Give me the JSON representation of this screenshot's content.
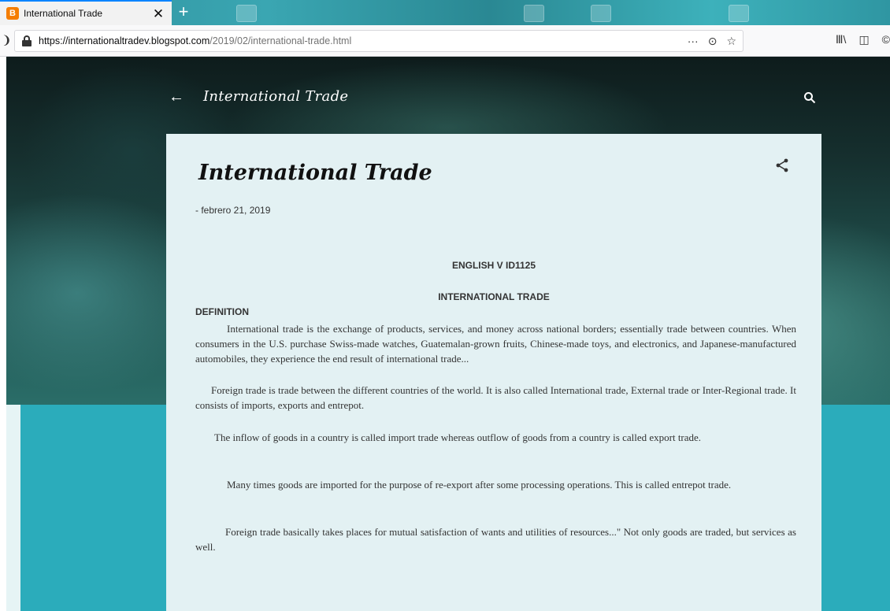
{
  "browser": {
    "tab": {
      "title": "International Trade",
      "favicon": "B",
      "close": "✕"
    },
    "new_tab": "+",
    "url_host": "https://internationaltradev.blogspot.com",
    "url_path": "/2019/02/international-trade.html",
    "url_actions": {
      "more": "···",
      "pocket": "⊙",
      "bookmark": "☆"
    },
    "toolbar_right": {
      "library": "Ⅲ\\",
      "sidebar": "◫",
      "extension": "©"
    }
  },
  "blog": {
    "title": "International Trade",
    "back_arrow": "←"
  },
  "post": {
    "title": "International Trade",
    "date": "- febrero 21, 2019",
    "heading_1": "ENGLISH V ID1125",
    "heading_2": "INTERNATIONAL TRADE",
    "definition_heading": "DEFINITION",
    "paragraphs": [
      "International trade is the exchange of products, services, and money across national borders; essentially trade between countries. When consumers in the U.S. purchase Swiss-made watches, Guatemalan-grown fruits, Chinese-made toys, and electronics, and Japanese-manufactured automobiles, they experience the end result of international trade...",
      "Foreign trade is trade between the different countries of the world.  It is also called International trade, External trade or Inter-Regional trade.  It consists of imports, exports and entrepot.",
      "The inflow of goods in a country is called import trade whereas outflow of goods from a country is called export trade.",
      "Many times goods are imported for the purpose of re-export after some processing operations.  This is called entrepot trade.",
      "Foreign trade basically takes places for mutual satisfaction of wants and utilities of resources...\" Not only goods are traded, but services as well."
    ]
  },
  "colors": {
    "page_background": "#2bacbb",
    "post_background": "#e3f1f3",
    "tab_accent": "#0a84ff",
    "favicon": "#f57d00"
  }
}
